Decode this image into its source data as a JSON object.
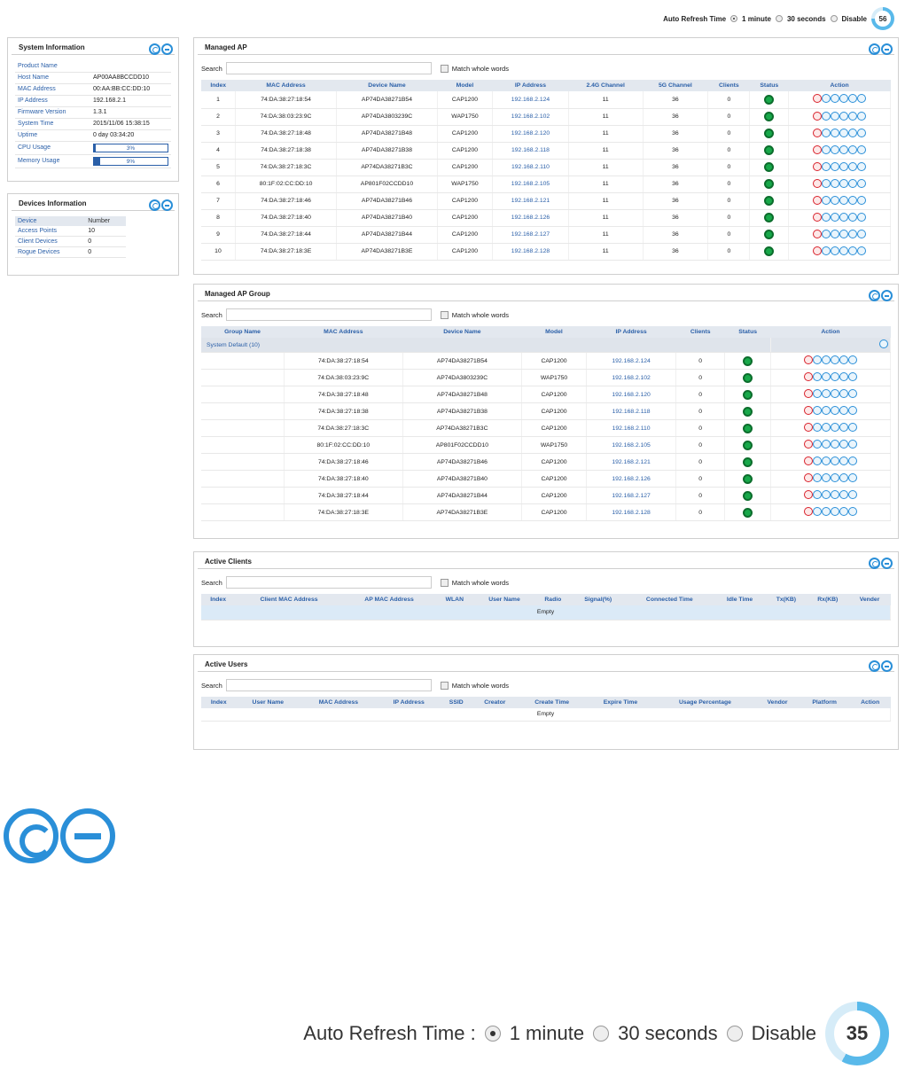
{
  "refresh": {
    "label": "Auto Refresh Time",
    "label_big": "Auto Refresh Time :",
    "options": [
      "1 minute",
      "30 seconds",
      "Disable"
    ],
    "selected": "1 minute",
    "countdown_top": "56",
    "countdown_big": "35"
  },
  "system_info": {
    "title": "System Information",
    "rows": [
      {
        "label": "Product Name",
        "value": ""
      },
      {
        "label": "Host Name",
        "value": "AP00AA8BCCDD10"
      },
      {
        "label": "MAC Address",
        "value": "00:AA:BB:CC:DD:10"
      },
      {
        "label": "IP Address",
        "value": "192.168.2.1"
      },
      {
        "label": "Firmware Version",
        "value": "1.3.1"
      },
      {
        "label": "System Time",
        "value": "2015/11/06 15:38:15"
      },
      {
        "label": "Uptime",
        "value": "0 day 03:34:20"
      }
    ],
    "cpu_label": "CPU Usage",
    "cpu_value": "3%",
    "cpu_fraction": 0.03,
    "mem_label": "Memory Usage",
    "mem_value": "9%",
    "mem_fraction": 0.09
  },
  "devices_info": {
    "title": "Devices Information",
    "headers": [
      "Device",
      "Number"
    ],
    "rows": [
      [
        "Access Points",
        "10"
      ],
      [
        "Client Devices",
        "0"
      ],
      [
        "Rogue Devices",
        "0"
      ]
    ]
  },
  "common": {
    "search_label": "Search",
    "match_label": "Match whole words",
    "empty": "Empty"
  },
  "managed_ap": {
    "title": "Managed AP",
    "headers": [
      "Index",
      "MAC Address",
      "Device Name",
      "Model",
      "IP Address",
      "2.4G Channel",
      "5G Channel",
      "Clients",
      "Status",
      "Action"
    ],
    "rows": [
      [
        "1",
        "74:DA:38:27:18:54",
        "AP74DA38271B54",
        "CAP1200",
        "192.168.2.124",
        "11",
        "36",
        "0"
      ],
      [
        "2",
        "74:DA:38:03:23:9C",
        "AP74DA3803239C",
        "WAP1750",
        "192.168.2.102",
        "11",
        "36",
        "0"
      ],
      [
        "3",
        "74:DA:38:27:18:48",
        "AP74DA38271B48",
        "CAP1200",
        "192.168.2.120",
        "11",
        "36",
        "0"
      ],
      [
        "4",
        "74:DA:38:27:18:38",
        "AP74DA38271B38",
        "CAP1200",
        "192.168.2.118",
        "11",
        "36",
        "0"
      ],
      [
        "5",
        "74:DA:38:27:18:3C",
        "AP74DA38271B3C",
        "CAP1200",
        "192.168.2.110",
        "11",
        "36",
        "0"
      ],
      [
        "6",
        "80:1F:02:CC:DD:10",
        "AP801F02CCDD10",
        "WAP1750",
        "192.168.2.105",
        "11",
        "36",
        "0"
      ],
      [
        "7",
        "74:DA:38:27:18:46",
        "AP74DA38271B46",
        "CAP1200",
        "192.168.2.121",
        "11",
        "36",
        "0"
      ],
      [
        "8",
        "74:DA:38:27:18:40",
        "AP74DA38271B40",
        "CAP1200",
        "192.168.2.126",
        "11",
        "36",
        "0"
      ],
      [
        "9",
        "74:DA:38:27:18:44",
        "AP74DA38271B44",
        "CAP1200",
        "192.168.2.127",
        "11",
        "36",
        "0"
      ],
      [
        "10",
        "74:DA:38:27:18:3E",
        "AP74DA38271B3E",
        "CAP1200",
        "192.168.2.128",
        "11",
        "36",
        "0"
      ]
    ]
  },
  "managed_ap_group": {
    "title": "Managed AP Group",
    "headers": [
      "Group Name",
      "MAC Address",
      "Device Name",
      "Model",
      "IP Address",
      "Clients",
      "Status",
      "Action"
    ],
    "group_label": "System Default (10)",
    "rows": [
      [
        "74:DA:38:27:18:54",
        "AP74DA38271B54",
        "CAP1200",
        "192.168.2.124",
        "0"
      ],
      [
        "74:DA:38:03:23:9C",
        "AP74DA3803239C",
        "WAP1750",
        "192.168.2.102",
        "0"
      ],
      [
        "74:DA:38:27:18:48",
        "AP74DA38271B48",
        "CAP1200",
        "192.168.2.120",
        "0"
      ],
      [
        "74:DA:38:27:18:38",
        "AP74DA38271B38",
        "CAP1200",
        "192.168.2.118",
        "0"
      ],
      [
        "74:DA:38:27:18:3C",
        "AP74DA38271B3C",
        "CAP1200",
        "192.168.2.110",
        "0"
      ],
      [
        "80:1F:02:CC:DD:10",
        "AP801F02CCDD10",
        "WAP1750",
        "192.168.2.105",
        "0"
      ],
      [
        "74:DA:38:27:18:46",
        "AP74DA38271B46",
        "CAP1200",
        "192.168.2.121",
        "0"
      ],
      [
        "74:DA:38:27:18:40",
        "AP74DA38271B40",
        "CAP1200",
        "192.168.2.126",
        "0"
      ],
      [
        "74:DA:38:27:18:44",
        "AP74DA38271B44",
        "CAP1200",
        "192.168.2.127",
        "0"
      ],
      [
        "74:DA:38:27:18:3E",
        "AP74DA38271B3E",
        "CAP1200",
        "192.168.2.128",
        "0"
      ]
    ]
  },
  "active_clients": {
    "title": "Active Clients",
    "headers": [
      "Index",
      "Client MAC Address",
      "AP MAC Address",
      "WLAN",
      "User Name",
      "Radio",
      "Signal(%)",
      "Connected Time",
      "Idle Time",
      "Tx(KB)",
      "Rx(KB)",
      "Vender"
    ]
  },
  "active_users": {
    "title": "Active Users",
    "headers": [
      "Index",
      "User Name",
      "MAC Address",
      "IP Address",
      "SSID",
      "Creator",
      "Create Time",
      "Expire Time",
      "Usage Percentage",
      "Vendor",
      "Platform",
      "Action"
    ]
  },
  "colors": {
    "accent": "#2a8fd8",
    "link": "#2a5fa8",
    "status_ok": "#18a84a",
    "delete": "#d8202a"
  },
  "icons": {
    "panel_buttons": [
      "refresh-icon",
      "minimize-icon"
    ],
    "ap_actions": [
      "delete-icon",
      "edit-icon",
      "config-icon",
      "reboot-icon",
      "locate-icon",
      "upgrade-icon"
    ]
  }
}
